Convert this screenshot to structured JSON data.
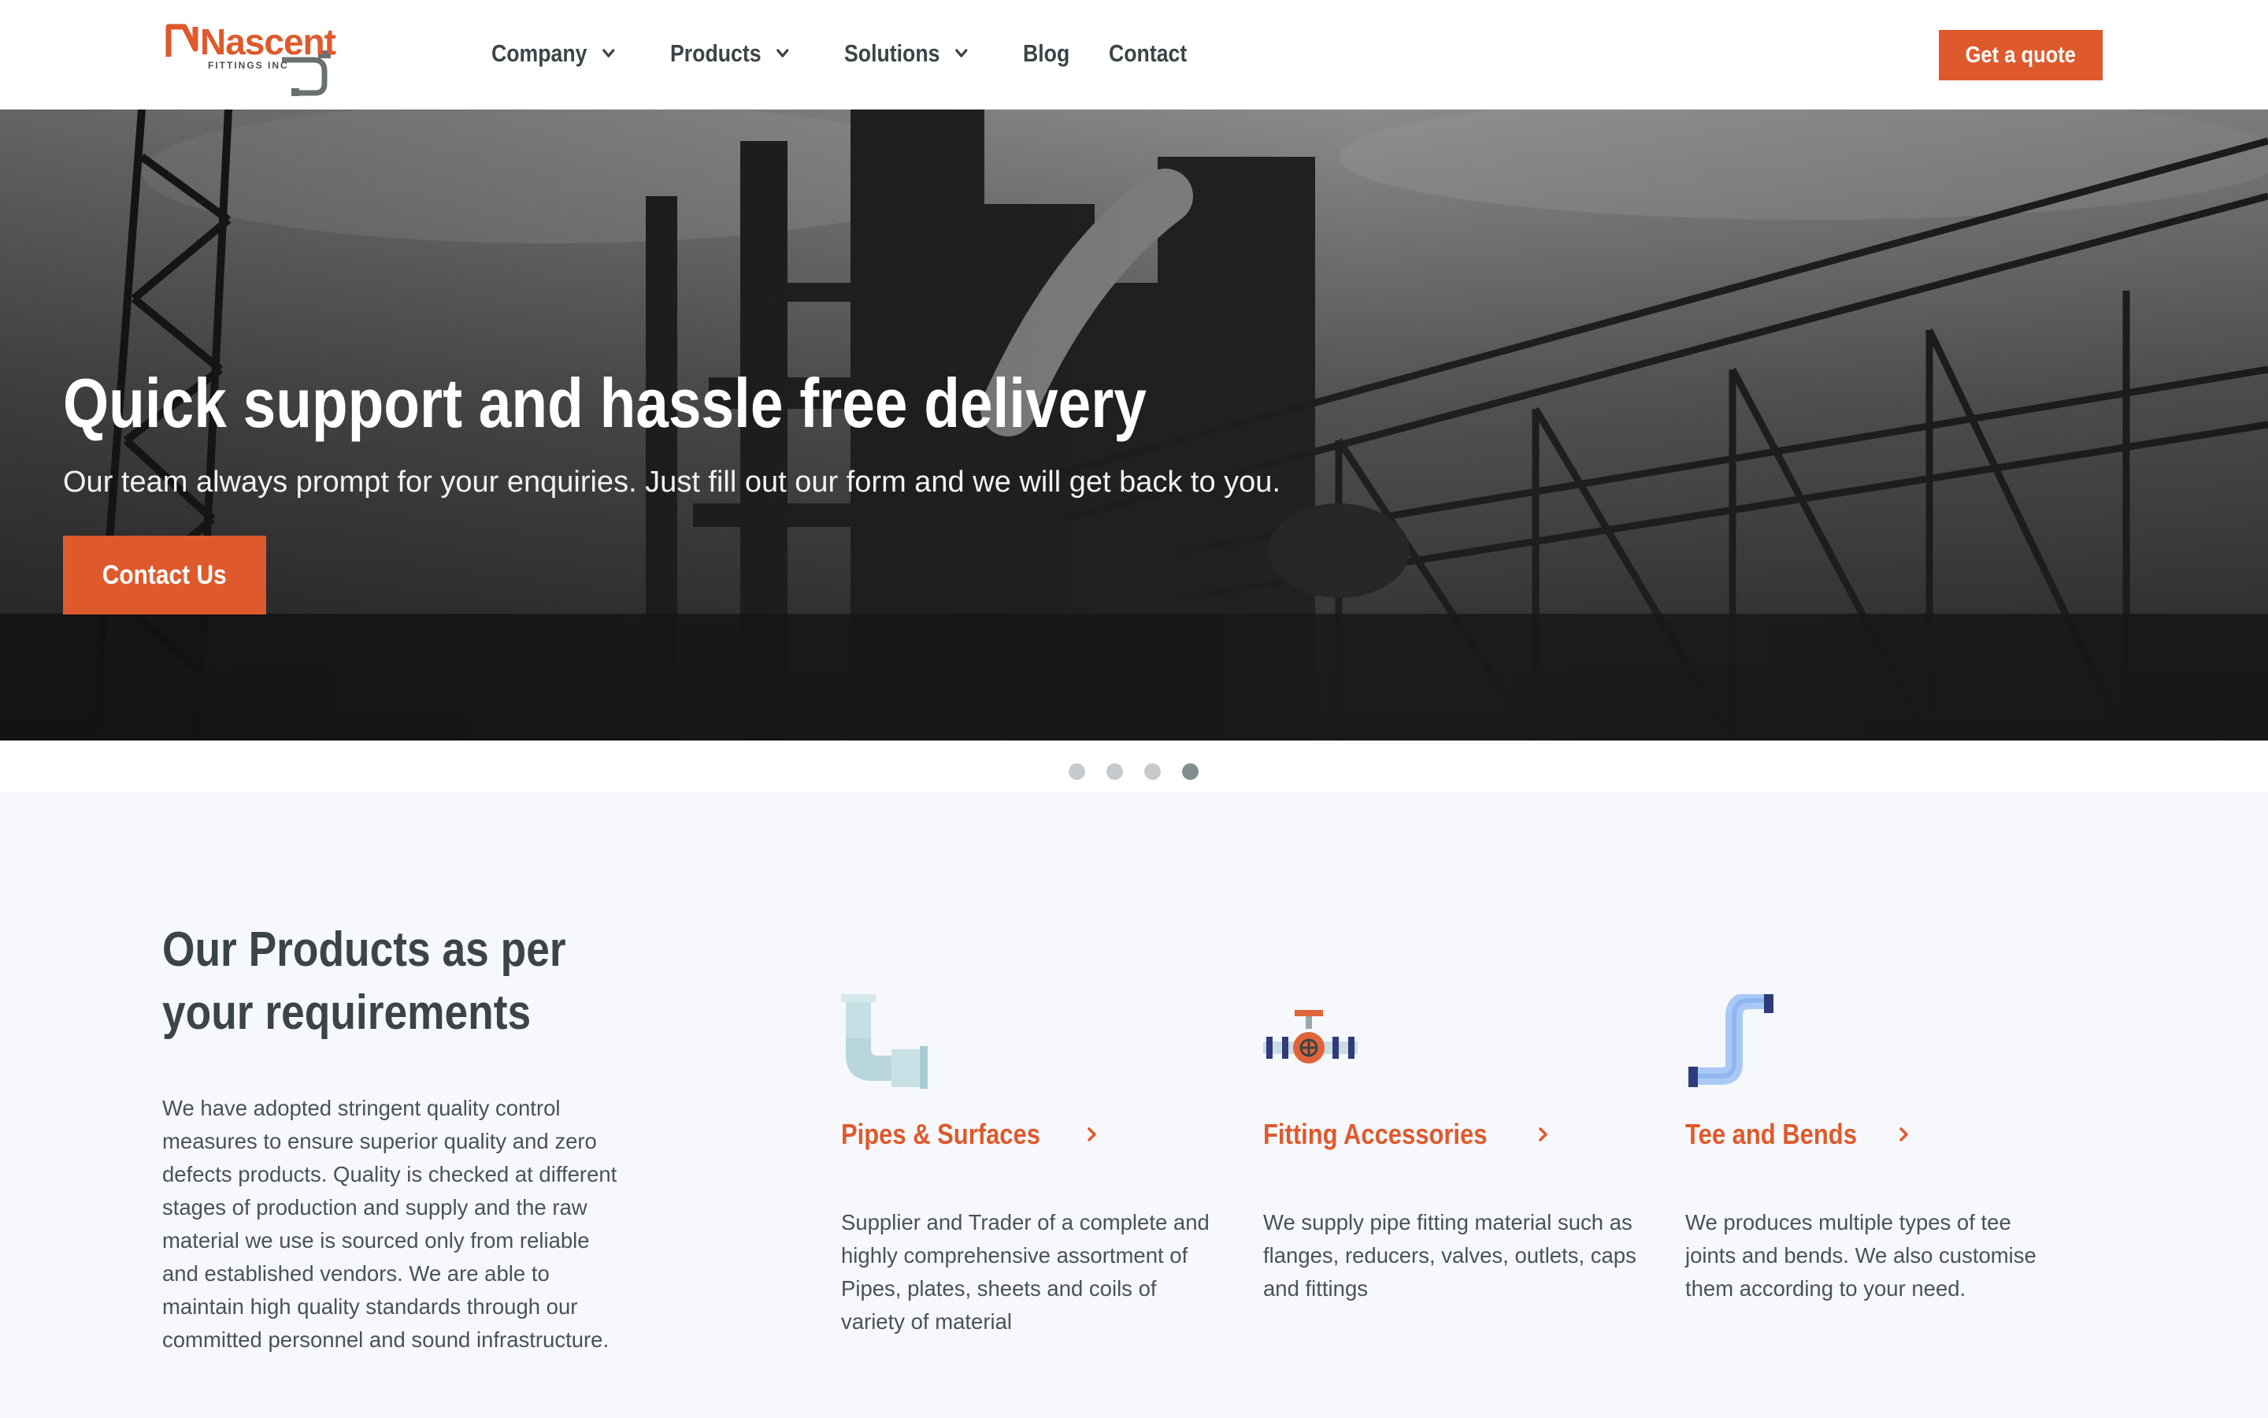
{
  "brand": {
    "name": "Nascent",
    "tagline": "FITTINGS INC",
    "colors": {
      "accent": "#de5a2c",
      "text": "#3b4447",
      "section_bg": "#f7f8fc"
    }
  },
  "nav": {
    "items": [
      {
        "label": "Company",
        "has_dropdown": true
      },
      {
        "label": "Products",
        "has_dropdown": true
      },
      {
        "label": "Solutions",
        "has_dropdown": true
      },
      {
        "label": "Blog",
        "has_dropdown": false
      },
      {
        "label": "Contact",
        "has_dropdown": false
      }
    ],
    "cta_label": "Get a quote"
  },
  "hero": {
    "title": "Quick support and hassle free delivery",
    "subtitle": "Our team always prompt for your enquiries. Just fill out our form and we will get back to you.",
    "button_label": "Contact Us",
    "slide_count": 4,
    "active_slide": 4
  },
  "products": {
    "title_line1": "Our Products as per",
    "title_line2": "your requirements",
    "description": "We have adopted stringent quality control measures to ensure superior quality and zero defects products. Quality is checked at different stages of production and supply and the raw material we use is sourced only from reliable and established vendors. We are able to maintain high quality standards through our committed personnel and sound infrastructure.",
    "cards": [
      {
        "icon": "pipe-elbow-icon",
        "title": "Pipes & Surfaces",
        "description": "Supplier and Trader of a complete and highly comprehensive assortment of Pipes, plates, sheets and coils of variety of material"
      },
      {
        "icon": "valve-icon",
        "title": "Fitting Accessories",
        "description": "We supply pipe fitting material such as flanges, reducers, valves, outlets, caps and fittings"
      },
      {
        "icon": "bent-pipe-icon",
        "title": "Tee and Bends",
        "description": "We produces multiple types of tee joints and bends. We also customise them according to your need."
      }
    ]
  }
}
